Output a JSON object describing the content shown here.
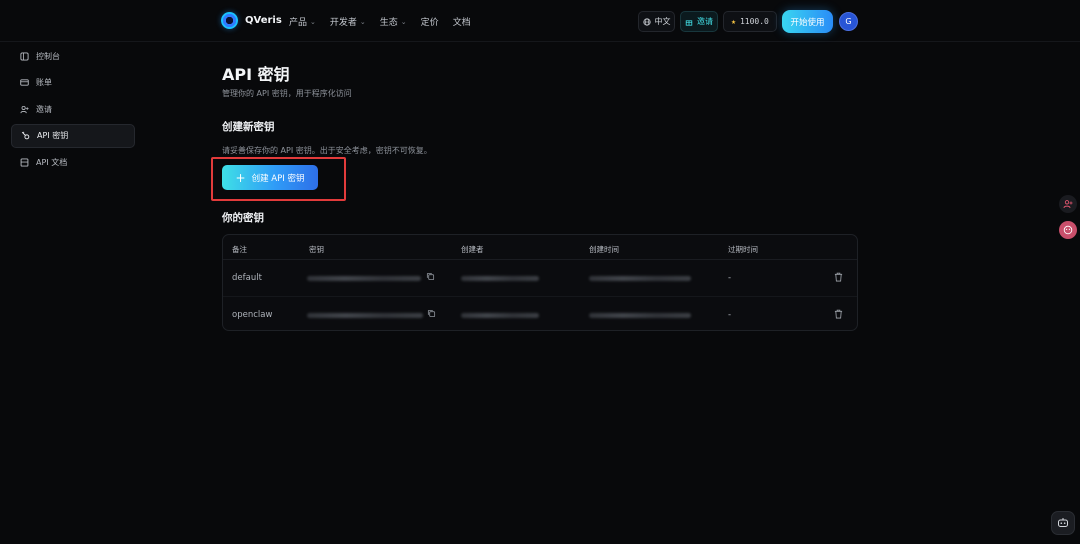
{
  "brand": {
    "name": "QVeris",
    "accent": "#2f9cf7"
  },
  "nav": {
    "items": [
      {
        "label": "产品",
        "has_dropdown": true
      },
      {
        "label": "开发者",
        "has_dropdown": true
      },
      {
        "label": "生态",
        "has_dropdown": true
      },
      {
        "label": "定价",
        "has_dropdown": false
      },
      {
        "label": "文档",
        "has_dropdown": false
      }
    ],
    "language": "中文",
    "invite": "邀请",
    "credits": "1100.0",
    "start": "开始使用",
    "avatar_initial": "G"
  },
  "sidebar": {
    "items": [
      {
        "label": "控制台",
        "icon": "dashboard-icon",
        "active": false
      },
      {
        "label": "账单",
        "icon": "card-icon",
        "active": false
      },
      {
        "label": "邀请",
        "icon": "user-plus-icon",
        "active": false
      },
      {
        "label": "API 密钥",
        "icon": "key-icon",
        "active": true
      },
      {
        "label": "API 文档",
        "icon": "doc-icon",
        "active": false
      }
    ]
  },
  "main": {
    "title": "API 密钥",
    "subtitle": "管理你的 API 密钥，用于程序化访问",
    "create_section": {
      "title": "创建新密钥",
      "description": "请妥善保存你的 API 密钥。出于安全考虑，密钥不可恢复。",
      "button": "创建 API 密钥"
    },
    "keys_section": {
      "title": "你的密钥",
      "columns": [
        "备注",
        "密钥",
        "创建者",
        "创建时间",
        "过期时间"
      ],
      "rows": [
        {
          "note": "default",
          "expiry": "-"
        },
        {
          "note": "openclaw",
          "expiry": "-"
        }
      ]
    }
  }
}
